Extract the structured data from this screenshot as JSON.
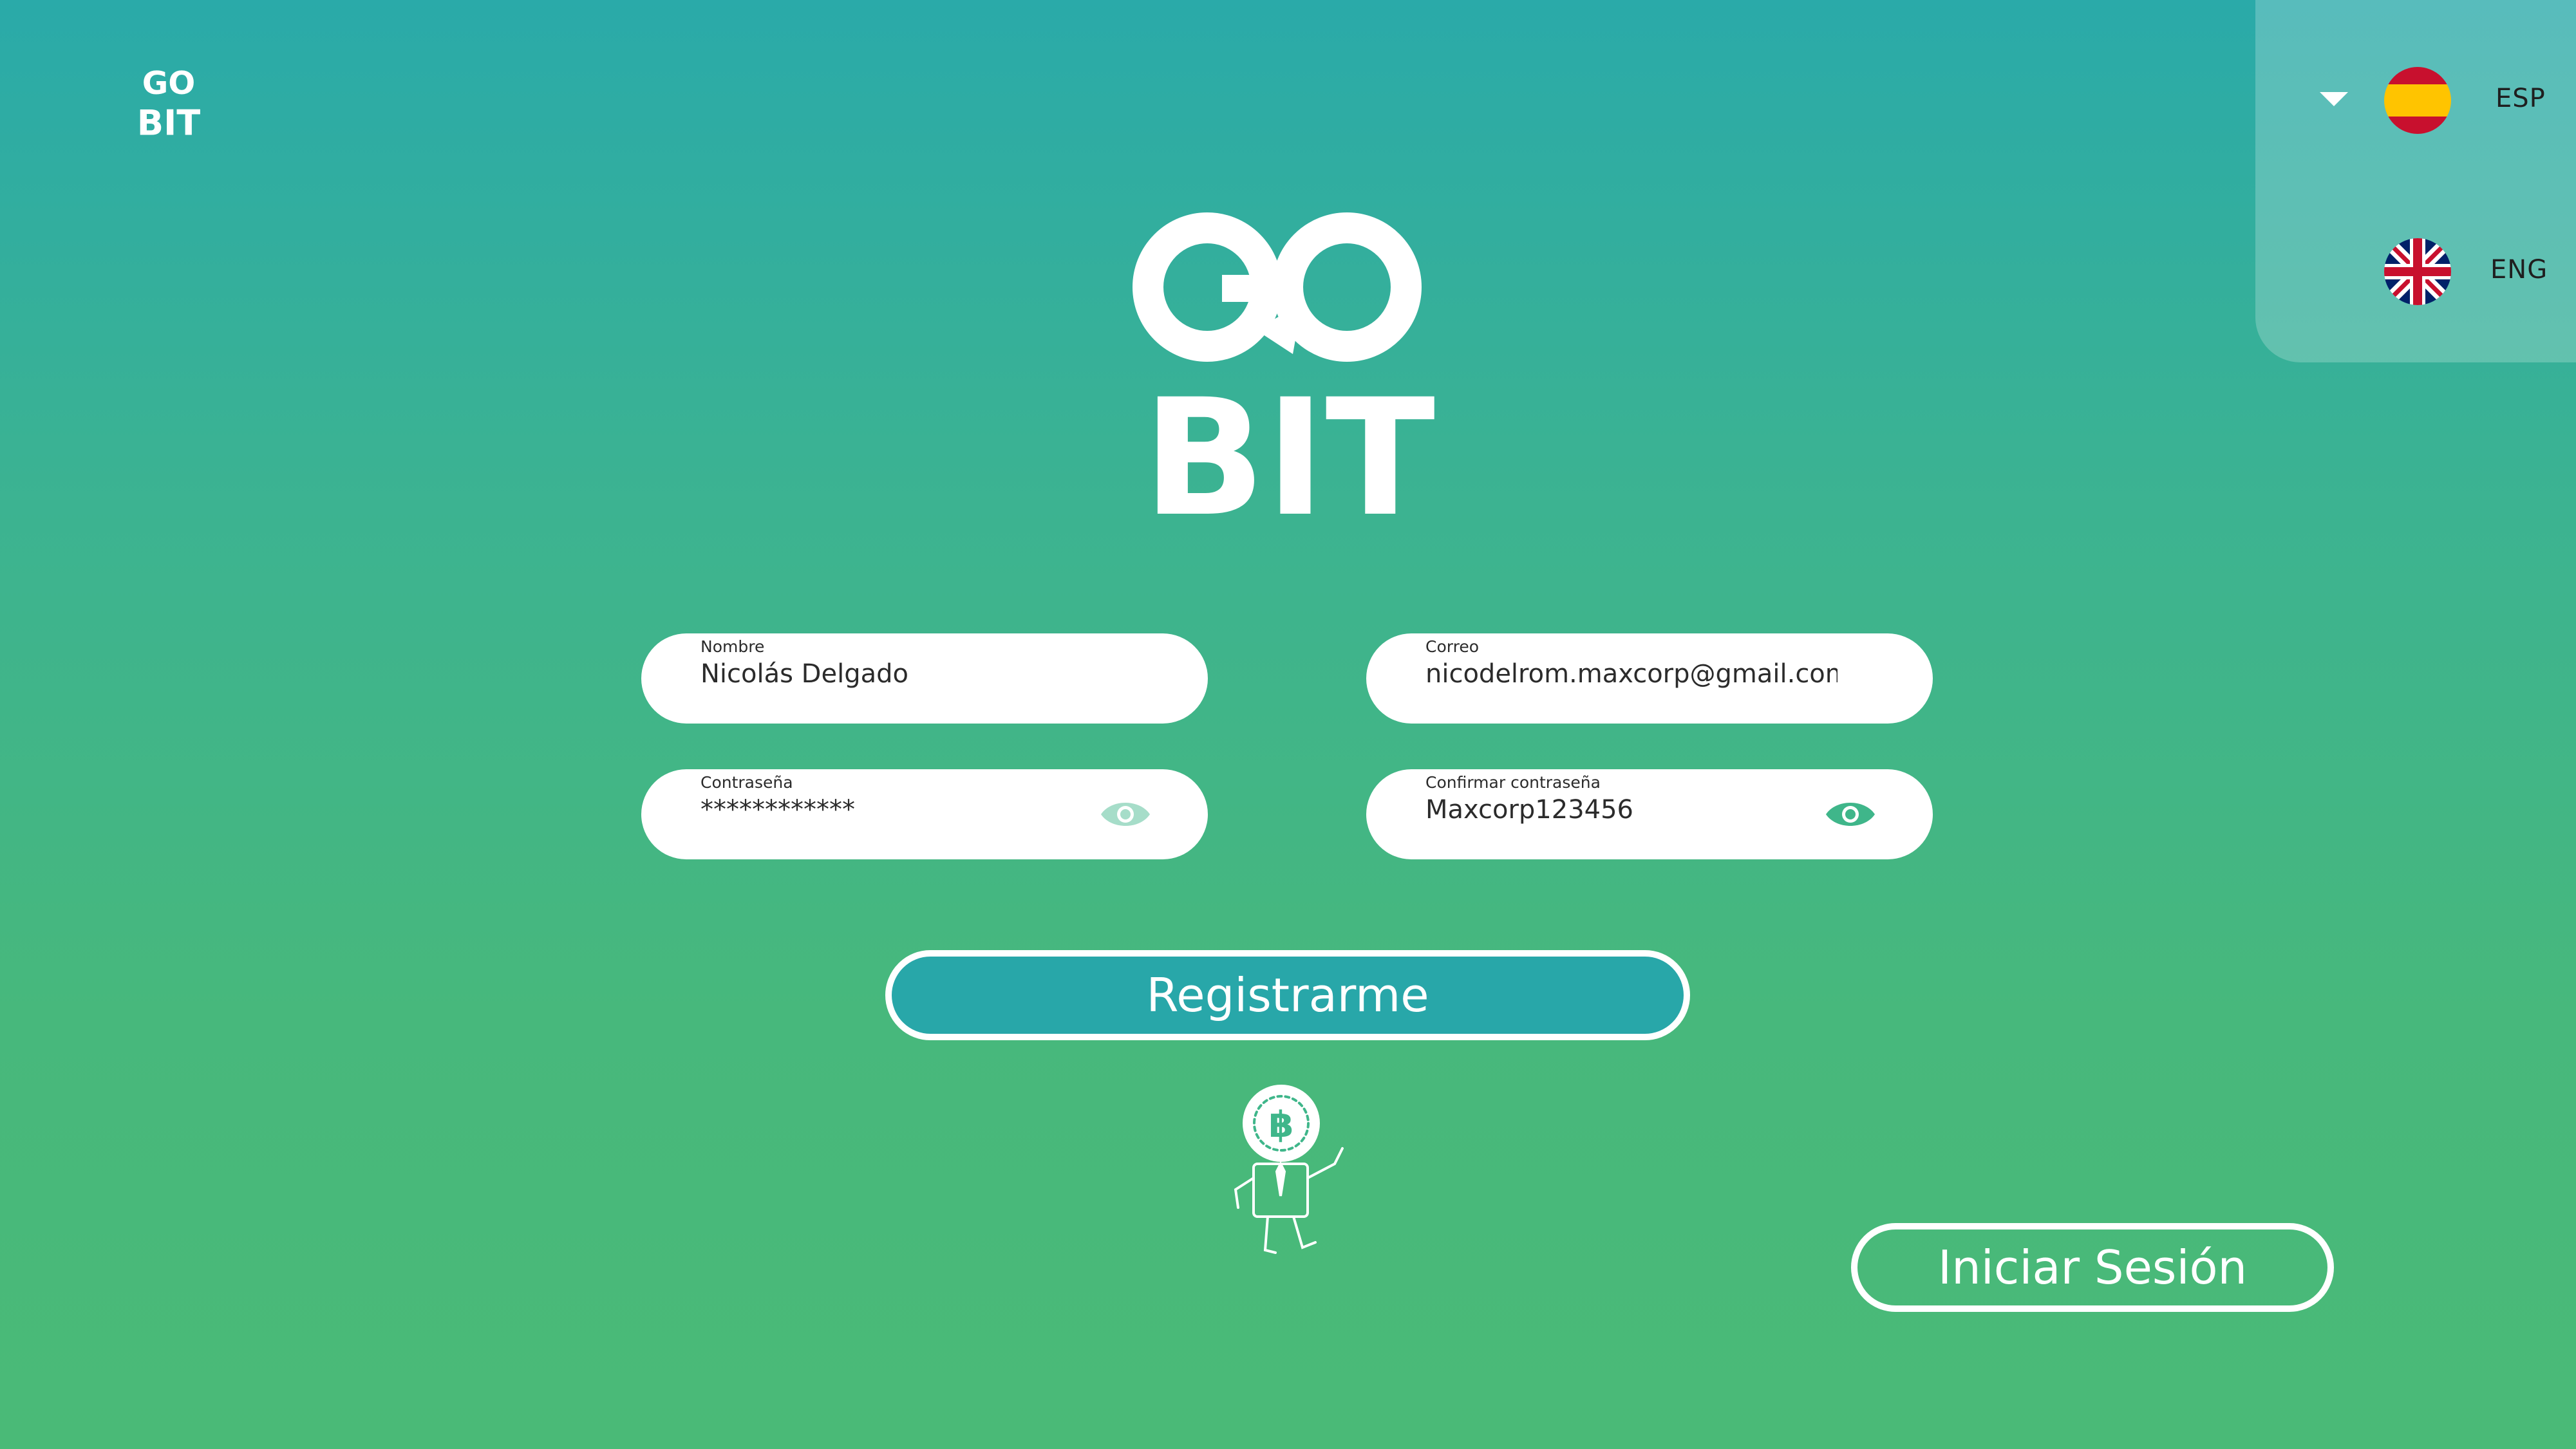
{
  "brand": {
    "logo_line1": "GO",
    "logo_line2": "BIT"
  },
  "language": {
    "options": [
      {
        "code": "ESP",
        "flag": "spain-flag"
      },
      {
        "code": "ENG",
        "flag": "uk-flag"
      }
    ]
  },
  "form": {
    "name": {
      "label": "Nombre",
      "value": "Nicolás Delgado"
    },
    "email": {
      "label": "Correo",
      "value": "nicodelrom.maxcorp@gmail.com"
    },
    "password": {
      "label": "Contraseña",
      "value": "************"
    },
    "confirm": {
      "label": "Confirmar contraseña",
      "value": "Maxcorp123456"
    }
  },
  "actions": {
    "register_label": "Registrarme",
    "login_label": "Iniciar Sesión"
  },
  "colors": {
    "accent": "#28a7a9",
    "eye_inactive": "#a6ddc9",
    "eye_active": "#3fb68a",
    "white": "#ffffff"
  },
  "icons": {
    "password_toggle": "eye-icon",
    "mascot": "coin-mascot-illustration"
  }
}
